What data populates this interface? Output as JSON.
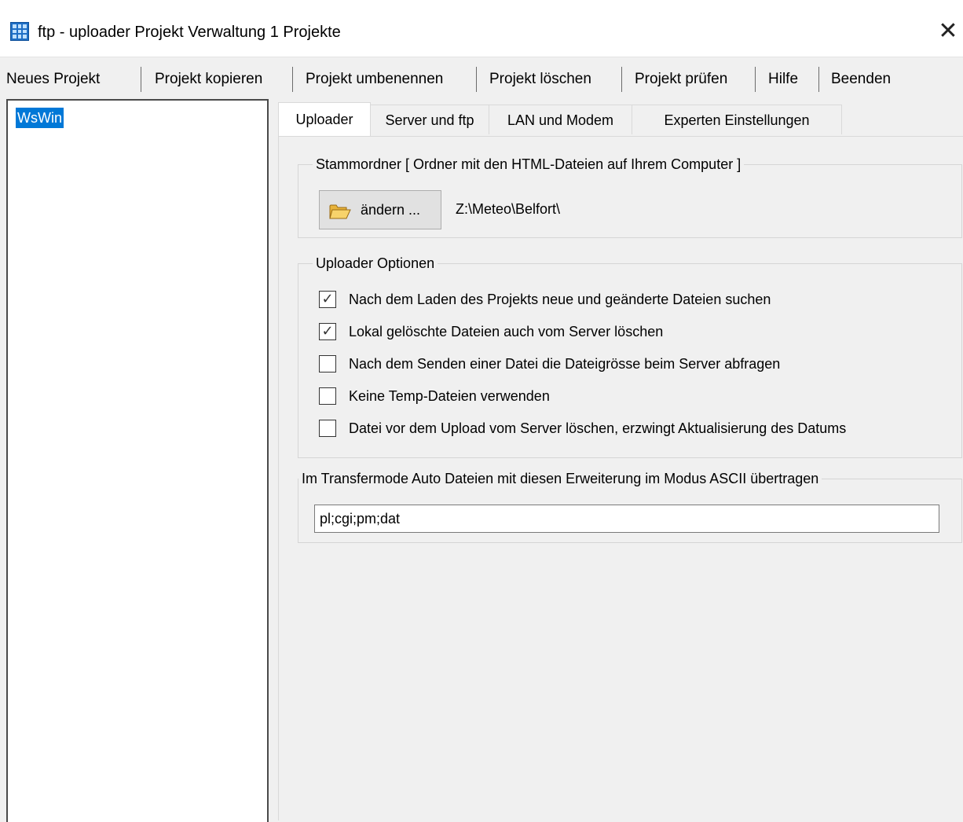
{
  "window": {
    "title": "ftp - uploader Projekt Verwaltung 1 Projekte",
    "close_glyph": "✕",
    "icon": "app-grid-icon"
  },
  "toolbar": {
    "new_project": "Neues Projekt",
    "copy_project": "Projekt kopieren",
    "rename_project": "Projekt umbenennen",
    "delete_project": "Projekt löschen",
    "check_project": "Projekt prüfen",
    "help": "Hilfe",
    "quit": "Beenden"
  },
  "projects": {
    "items": [
      "WsWin"
    ],
    "selected_index": 0
  },
  "tabs": {
    "uploader": "Uploader",
    "server_ftp": "Server und ftp",
    "lan_modem": "LAN und Modem",
    "expert": "Experten Einstellungen",
    "active": "Uploader"
  },
  "root_folder": {
    "legend": "Stammordner  [ Ordner mit den HTML-Dateien auf Ihrem Computer ]",
    "change_button": "ändern ...",
    "path": "Z:\\Meteo\\Belfort\\"
  },
  "options": {
    "legend": "Uploader Optionen",
    "items": [
      {
        "label": "Nach dem Laden des Projekts neue und geänderte Dateien suchen",
        "checked": true
      },
      {
        "label": "Lokal gelöschte Dateien auch vom Server löschen",
        "checked": true
      },
      {
        "label": "Nach dem Senden einer Datei die Dateigrösse beim Server abfragen",
        "checked": false
      },
      {
        "label": "Keine Temp-Dateien verwenden",
        "checked": false
      },
      {
        "label": "Datei vor dem Upload vom Server löschen, erzwingt Aktualisierung des Datums",
        "checked": false
      }
    ]
  },
  "ascii": {
    "legend": "Im Transfermode Auto Dateien mit diesen Erweiterung im Modus ASCII übertragen",
    "value": "pl;cgi;pm;dat"
  },
  "check_glyph": "✓"
}
